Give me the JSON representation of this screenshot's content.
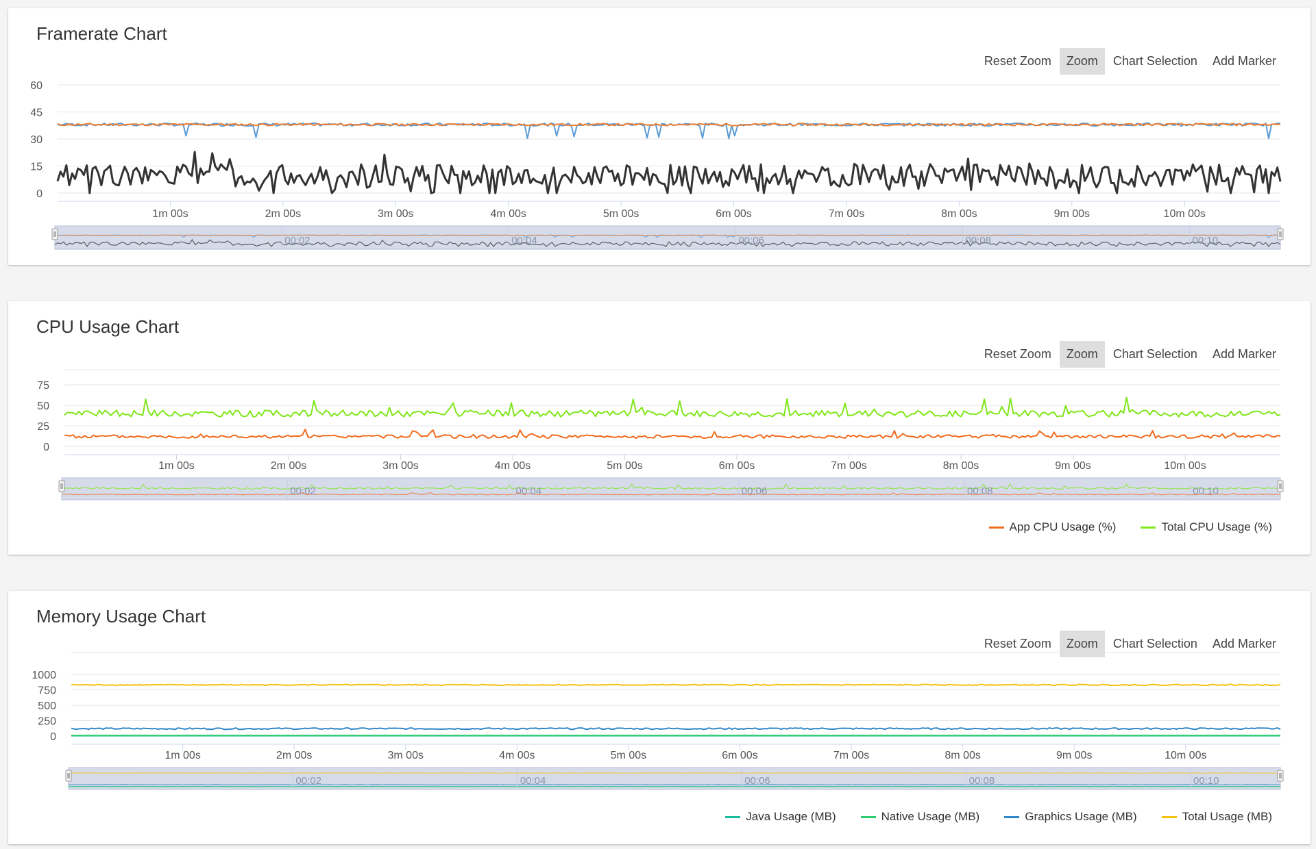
{
  "toolbar": {
    "reset_zoom": "Reset Zoom",
    "zoom": "Zoom",
    "chart_selection": "Chart Selection",
    "add_marker": "Add Marker"
  },
  "colors": {
    "fps_black": "#333333",
    "fps_blue": "#5b9bd5",
    "fps_orange": "#ed7d31",
    "app_cpu": "#f26b1d",
    "total_cpu": "#7fe619",
    "java": "#1abc9c",
    "native": "#2ecc71",
    "graphics": "#2f86c8",
    "total_mem": "#f5c211",
    "navigator_bg": "#d6dbea",
    "grid": "#e6e6e6"
  },
  "time_ticks": [
    "1m 00s",
    "2m 00s",
    "3m 00s",
    "4m 00s",
    "5m 00s",
    "6m 00s",
    "7m 00s",
    "8m 00s",
    "9m 00s",
    "10m 00s"
  ],
  "nav_ticks": [
    "00:02",
    "00:04",
    "00:06",
    "00:08",
    "00:10"
  ],
  "chart_data": [
    {
      "id": "fps",
      "type": "line",
      "title": "Framerate Chart",
      "x_unit": "minutes",
      "xlim": [
        0,
        10.85
      ],
      "ylim": [
        0,
        60
      ],
      "yticks": [
        "60",
        "45",
        "30",
        "15",
        "0"
      ],
      "grid": true,
      "legend": "none",
      "series": [
        {
          "key": "fps_main",
          "color": "#333333",
          "base": 10,
          "noise": 6,
          "spike": 12,
          "spikeEvery": 9,
          "seed": 3
        },
        {
          "key": "fps_blue",
          "color": "#5b9bd5",
          "base": 38,
          "noise": 0.8,
          "dip": -7,
          "seed": 7
        },
        {
          "key": "fps_orange",
          "color": "#ed7d31",
          "base": 38,
          "noise": 0.6,
          "seed": 11
        }
      ]
    },
    {
      "id": "cpu",
      "type": "line",
      "title": "CPU Usage Chart",
      "x_unit": "minutes",
      "xlim": [
        0,
        10.85
      ],
      "ylim": [
        0,
        75
      ],
      "yticks": [
        "75",
        "50",
        "25",
        "0"
      ],
      "grid": true,
      "legend": "bottom-right",
      "series": [
        {
          "name": "App CPU Usage (%)",
          "color": "#f26b1d",
          "base": 12,
          "noise": 2,
          "spike": 8,
          "seed": 5
        },
        {
          "name": "Total CPU Usage (%)",
          "color": "#7fe619",
          "base": 40,
          "noise": 4,
          "spike": 18,
          "seed": 9
        }
      ]
    },
    {
      "id": "mem",
      "type": "line",
      "title": "Memory Usage Chart",
      "x_unit": "minutes",
      "xlim": [
        0,
        10.85
      ],
      "ylim": [
        0,
        1000
      ],
      "yticks": [
        "1000",
        "750",
        "500",
        "250",
        "0"
      ],
      "grid": true,
      "legend": "bottom-right",
      "series": [
        {
          "name": "Java Usage (MB)",
          "color": "#1abc9c",
          "base": 5,
          "noise": 0,
          "seed": 2
        },
        {
          "name": "Native Usage (MB)",
          "color": "#2ecc71",
          "base": 10,
          "noise": 0,
          "seed": 4
        },
        {
          "name": "Graphics Usage (MB)",
          "color": "#2f86c8",
          "base": 120,
          "noise": 12,
          "seed": 6
        },
        {
          "name": "Total Usage (MB)",
          "color": "#f5c211",
          "base": 830,
          "noise": 8,
          "seed": 8
        }
      ]
    }
  ]
}
